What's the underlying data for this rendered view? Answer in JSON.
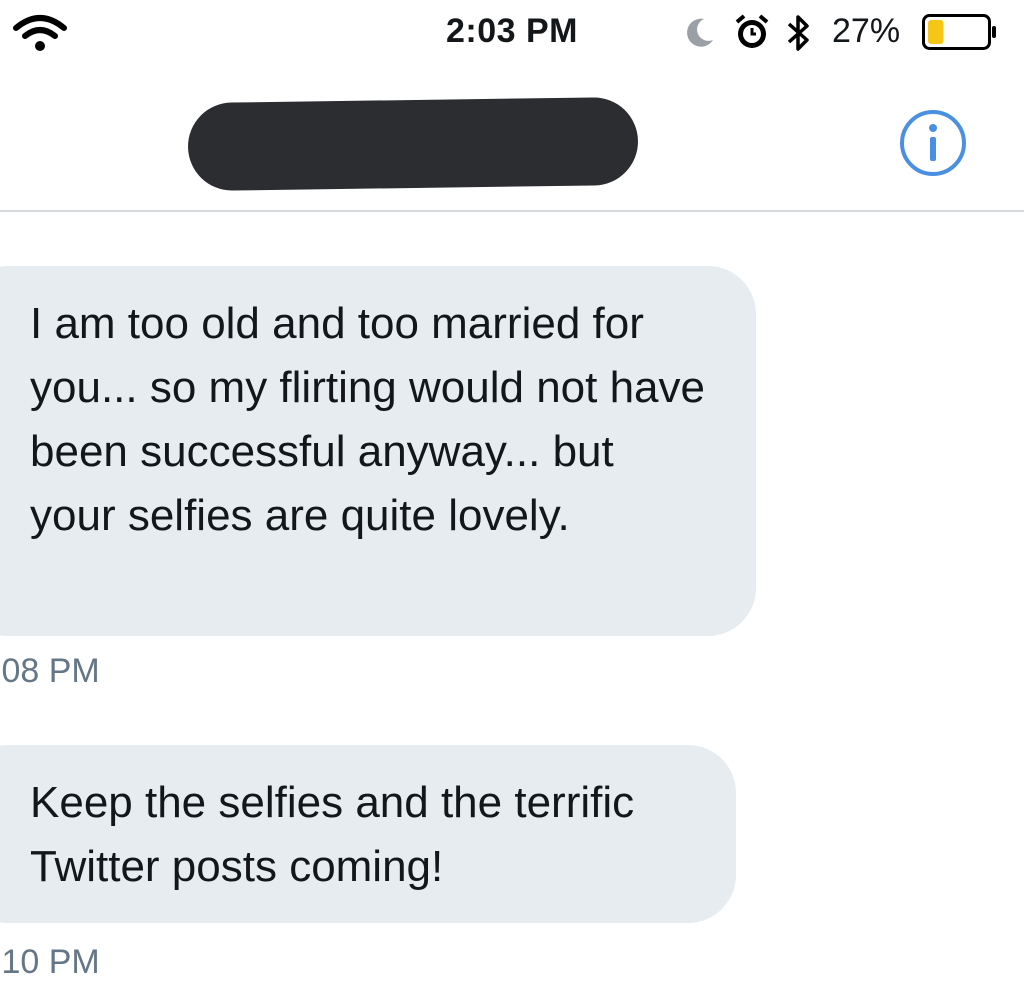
{
  "status_bar": {
    "time": "2:03 PM",
    "battery_percent_label": "27%",
    "battery_level": 0.27,
    "battery_color": "#f5c518",
    "icons": [
      "wifi-icon",
      "moon-icon",
      "alarm-icon",
      "bluetooth-icon",
      "battery-icon"
    ]
  },
  "header": {
    "title_redacted": true,
    "info_icon": "info-icon",
    "accent_color": "#4a90e2"
  },
  "messages": [
    {
      "text": "I am too old and too married for you... so my flirting would not have been successful anyway... but your selfies are quite lovely.",
      "time": ":08 PM"
    },
    {
      "text": "Keep the selfies and the terrific Twitter posts coming!",
      "time": ":10 PM"
    }
  ],
  "colors": {
    "bubble_bg": "#e6ecf0",
    "timestamp": "#657786",
    "text": "#14171a"
  }
}
